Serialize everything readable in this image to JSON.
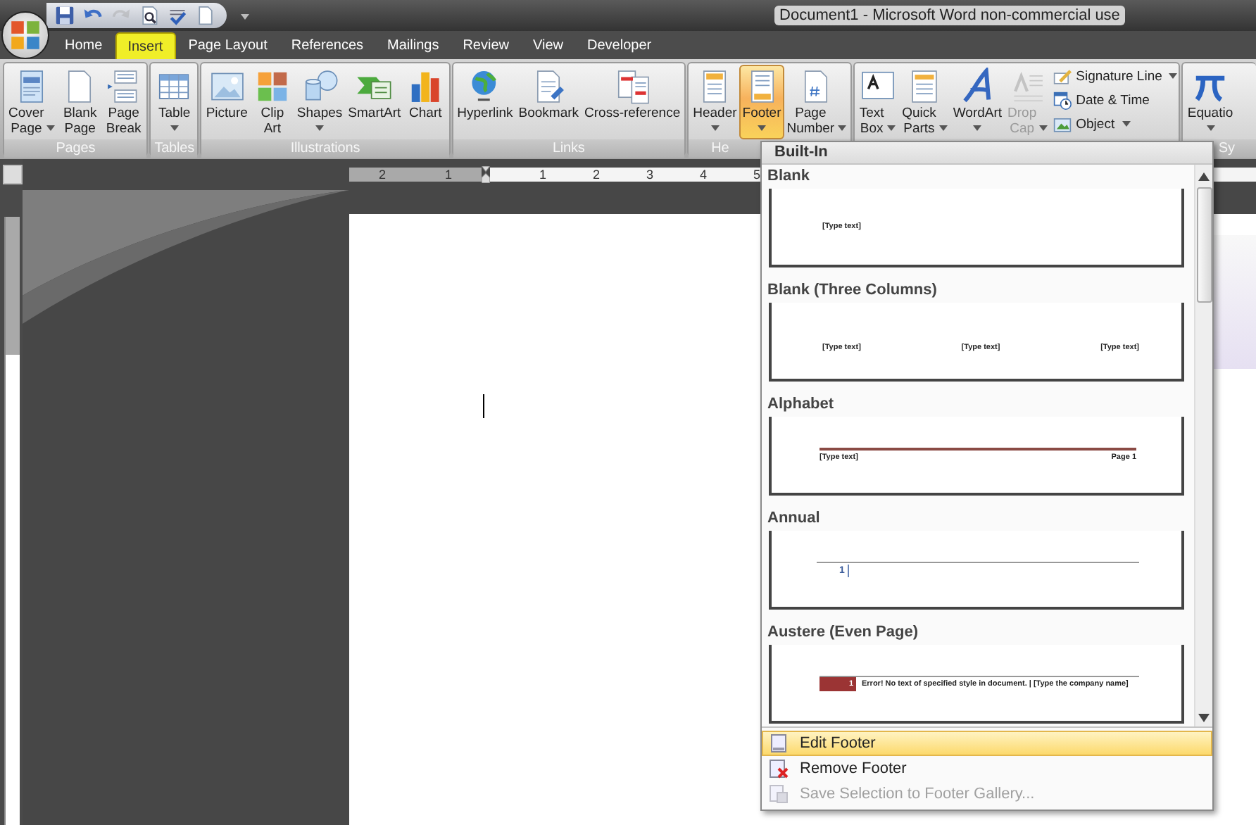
{
  "window": {
    "title": "Document1 - Microsoft Word non-commercial use"
  },
  "quick_access": [
    {
      "kind": "save",
      "disabled": false
    },
    {
      "kind": "undo",
      "disabled": false
    },
    {
      "kind": "redo",
      "disabled": true
    },
    {
      "kind": "preview",
      "disabled": false
    },
    {
      "kind": "spelling",
      "disabled": false
    },
    {
      "kind": "new",
      "disabled": false
    }
  ],
  "tabs": [
    {
      "label": "Home",
      "selected": false
    },
    {
      "label": "Insert",
      "selected": true
    },
    {
      "label": "Page Layout",
      "selected": false
    },
    {
      "label": "References",
      "selected": false
    },
    {
      "label": "Mailings",
      "selected": false
    },
    {
      "label": "Review",
      "selected": false
    },
    {
      "label": "View",
      "selected": false
    },
    {
      "label": "Developer",
      "selected": false
    }
  ],
  "ribbon": {
    "groups": [
      {
        "label": "Pages",
        "label_cut": false,
        "buttons": [
          {
            "kind": "cover",
            "label": "Cover Page",
            "dropdown": true,
            "pressed": false,
            "disabled": false
          },
          {
            "kind": "blank",
            "label": "Blank Page",
            "dropdown": false,
            "pressed": false,
            "disabled": false
          },
          {
            "kind": "pagebreak",
            "label": "Page Break",
            "dropdown": false,
            "pressed": false,
            "disabled": false
          }
        ]
      },
      {
        "label": "Tables",
        "label_cut": false,
        "buttons": [
          {
            "kind": "table",
            "label": "Table",
            "dropdown": true,
            "pressed": false,
            "disabled": false
          }
        ]
      },
      {
        "label": "Illustrations",
        "label_cut": false,
        "buttons": [
          {
            "kind": "picture",
            "label": "Picture",
            "dropdown": false,
            "pressed": false,
            "disabled": false
          },
          {
            "kind": "clipart",
            "label": "Clip Art",
            "dropdown": false,
            "pressed": false,
            "disabled": false
          },
          {
            "kind": "shapes",
            "label": "Shapes",
            "dropdown": true,
            "pressed": false,
            "disabled": false
          },
          {
            "kind": "smartart",
            "label": "SmartArt",
            "dropdown": false,
            "pressed": false,
            "disabled": false
          },
          {
            "kind": "chart",
            "label": "Chart",
            "dropdown": false,
            "pressed": false,
            "disabled": false
          }
        ]
      },
      {
        "label": "Links",
        "label_cut": false,
        "buttons": [
          {
            "kind": "hyperlink",
            "label": "Hyperlink",
            "dropdown": false,
            "pressed": false,
            "disabled": false
          },
          {
            "kind": "bookmark",
            "label": "Bookmark",
            "dropdown": false,
            "pressed": false,
            "disabled": false
          },
          {
            "kind": "crossref",
            "label": "Cross-reference",
            "dropdown": false,
            "pressed": false,
            "disabled": false
          }
        ]
      },
      {
        "label": "He",
        "label_cut": true,
        "buttons": [
          {
            "kind": "header",
            "label": "Header",
            "dropdown": true,
            "pressed": false,
            "disabled": false
          },
          {
            "kind": "footer",
            "label": "Footer",
            "dropdown": true,
            "pressed": true,
            "disabled": false
          },
          {
            "kind": "pagenumber",
            "label": "Page Number",
            "dropdown": true,
            "pressed": false,
            "disabled": false
          }
        ]
      },
      {
        "buttons": [
          {
            "kind": "textbox",
            "label": "Text Box",
            "dropdown": true,
            "pressed": false,
            "disabled": false
          },
          {
            "kind": "quickparts",
            "label": "Quick Parts",
            "dropdown": true,
            "pressed": false,
            "disabled": false
          },
          {
            "kind": "wordart",
            "label": "WordArt",
            "dropdown": true,
            "pressed": false,
            "disabled": false
          },
          {
            "kind": "dropcap",
            "label": "Drop Cap",
            "dropdown": true,
            "pressed": false,
            "disabled": true
          }
        ],
        "small_buttons": [
          {
            "kind": "signature",
            "label": "Signature Line",
            "dropdown": true
          },
          {
            "kind": "datetime",
            "label": "Date & Time",
            "dropdown": false
          },
          {
            "kind": "object",
            "label": "Object",
            "dropdown": true
          }
        ]
      },
      {
        "label": "Sy",
        "label_cut": true,
        "buttons": [
          {
            "kind": "equation",
            "label": "Equatio",
            "dropdown": true,
            "pressed": false,
            "disabled": false
          }
        ]
      }
    ]
  },
  "ruler": {
    "labels": [
      {
        "text": "2",
        "in_margin": true
      },
      {
        "text": "1",
        "in_margin": true
      },
      {
        "text": "1",
        "in_margin": false
      },
      {
        "text": "2",
        "in_margin": false
      },
      {
        "text": "3",
        "in_margin": false
      },
      {
        "text": "4",
        "in_margin": false
      },
      {
        "text": "5",
        "in_margin": false
      }
    ]
  },
  "footer_menu": {
    "heading": "Built-In",
    "gallery": [
      {
        "title": "Blank",
        "kind": "blank",
        "texts": [
          "[Type text]"
        ]
      },
      {
        "title": "Blank (Three Columns)",
        "kind": "three",
        "texts": [
          "[Type text]",
          "[Type text]",
          "[Type text]"
        ]
      },
      {
        "title": "Alphabet",
        "kind": "alphabet",
        "texts": [
          "[Type text]",
          "Page 1"
        ]
      },
      {
        "title": "Annual",
        "kind": "annual",
        "texts": [
          "1"
        ]
      },
      {
        "title": "Austere (Even Page)",
        "kind": "austere",
        "texts": [
          "1",
          "Error! No text of specified style in document. | [Type the company name]"
        ]
      }
    ],
    "commands": [
      {
        "kind": "edit",
        "label": "Edit Footer",
        "selected": true,
        "disabled": false
      },
      {
        "kind": "remove",
        "label": "Remove Footer",
        "selected": false,
        "disabled": false
      },
      {
        "kind": "save",
        "label": "Save Selection to Footer Gallery...",
        "selected": false,
        "disabled": true
      }
    ]
  }
}
